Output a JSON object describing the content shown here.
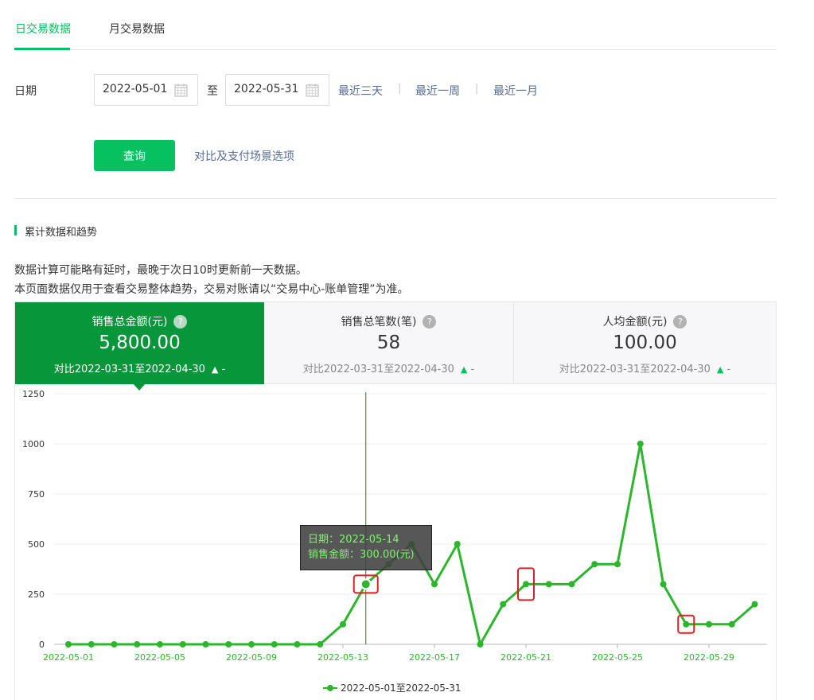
{
  "tabs": [
    {
      "label": "日交易数据",
      "active": true
    },
    {
      "label": "月交易数据",
      "active": false
    }
  ],
  "filters": {
    "date_label": "日期",
    "start_date": "2022-05-01",
    "to_label": "至",
    "end_date": "2022-05-31",
    "quick_links": [
      "最近三天",
      "最近一周",
      "最近一月"
    ],
    "separator": "|",
    "query_button": "查询",
    "compare_link": "对比及支付场景选项"
  },
  "section": {
    "title": "累计数据和趋势",
    "note_line1": "数据计算可能略有延时，最晚于次日10时更新前一天数据。",
    "note_line2": "本页面数据仅用于查看交易整体趋势，交易对账请以“交易中心-账单管理”为准。"
  },
  "cards": [
    {
      "title": "销售总金额(元)",
      "value": "5,800.00",
      "compare": "对比2022-03-31至2022-04-30",
      "change": "-",
      "active": true
    },
    {
      "title": "销售总笔数(笔)",
      "value": "58",
      "compare": "对比2022-03-31至2022-04-30",
      "change": "-",
      "active": false
    },
    {
      "title": "人均金额(元)",
      "value": "100.00",
      "compare": "对比2022-03-31至2022-04-30",
      "change": "-",
      "active": false
    }
  ],
  "icons": {
    "help": "?",
    "up_arrow": "▲"
  },
  "colors": {
    "accent": "#07c160",
    "active_card": "#07963a",
    "series": "#2bb62b",
    "link": "#576b95",
    "highlight_box": "#e02020"
  },
  "tooltip": {
    "line1": "日期：2022-05-14",
    "line2": "销售金额：300.00(元)"
  },
  "chart_data": {
    "type": "line",
    "x": [
      "2022-05-01",
      "2022-05-02",
      "2022-05-03",
      "2022-05-04",
      "2022-05-05",
      "2022-05-06",
      "2022-05-07",
      "2022-05-08",
      "2022-05-09",
      "2022-05-10",
      "2022-05-11",
      "2022-05-12",
      "2022-05-13",
      "2022-05-14",
      "2022-05-15",
      "2022-05-16",
      "2022-05-17",
      "2022-05-18",
      "2022-05-19",
      "2022-05-20",
      "2022-05-21",
      "2022-05-22",
      "2022-05-23",
      "2022-05-24",
      "2022-05-25",
      "2022-05-26",
      "2022-05-27",
      "2022-05-28",
      "2022-05-29",
      "2022-05-30",
      "2022-05-31"
    ],
    "x_tick_labels": [
      "2022-05-01",
      "2022-05-05",
      "2022-05-09",
      "2022-05-13",
      "2022-05-17",
      "2022-05-21",
      "2022-05-25",
      "2022-05-29"
    ],
    "y_ticks": [
      "0",
      "250",
      "500",
      "750",
      "1000",
      "1250"
    ],
    "ylim": [
      0,
      1250
    ],
    "grid": true,
    "legend_position": "bottom-center",
    "series": [
      {
        "name": "2022-05-01至2022-05-31",
        "values": [
          0,
          0,
          0,
          0,
          0,
          0,
          0,
          0,
          0,
          0,
          0,
          0,
          100,
          300,
          400,
          500,
          300,
          500,
          0,
          200,
          300,
          300,
          300,
          400,
          400,
          1000,
          300,
          100,
          100,
          100,
          200
        ]
      }
    ],
    "hover_index": 13,
    "highlight_indices": [
      13,
      20,
      27
    ]
  }
}
